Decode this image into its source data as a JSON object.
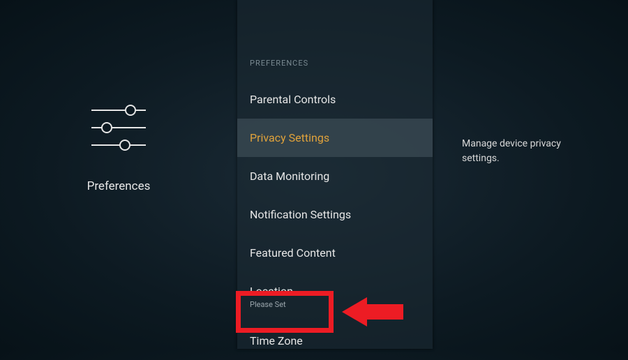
{
  "left": {
    "label": "Preferences"
  },
  "center": {
    "header": "PREFERENCES",
    "items": [
      {
        "label": "Parental Controls"
      },
      {
        "label": "Privacy Settings"
      },
      {
        "label": "Data Monitoring"
      },
      {
        "label": "Notification Settings"
      },
      {
        "label": "Featured Content"
      },
      {
        "label": "Location",
        "subtext": "Please Set"
      },
      {
        "label": "Time Zone"
      }
    ]
  },
  "right": {
    "description": "Manage device privacy settings."
  }
}
